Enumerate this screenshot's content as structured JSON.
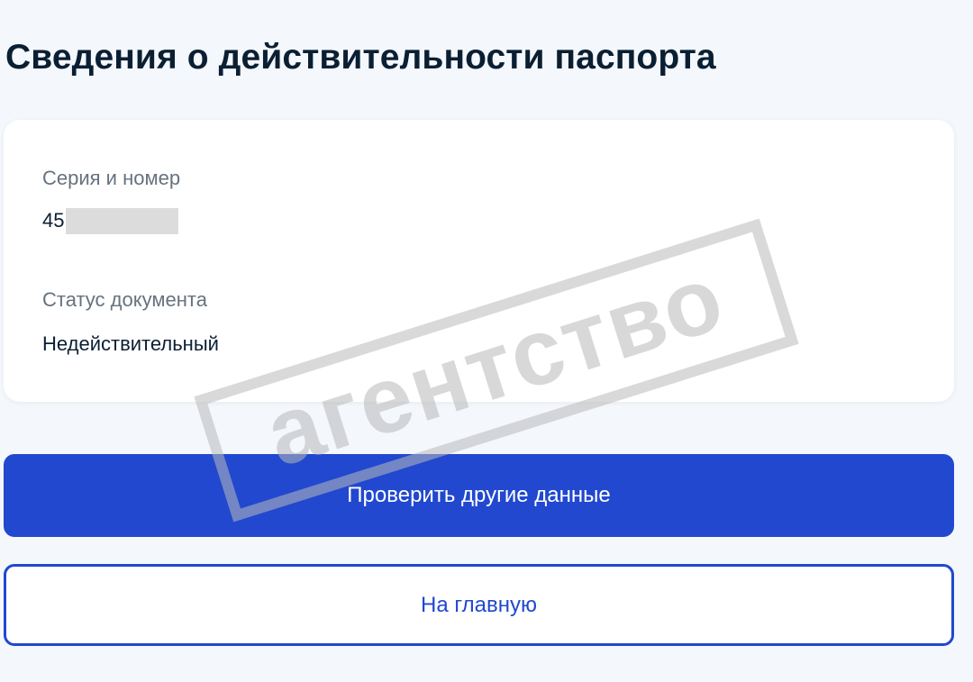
{
  "page": {
    "title": "Сведения о действительности паспорта"
  },
  "card": {
    "series_label": "Серия и номер",
    "series_value_visible": "45",
    "status_label": "Статус документа",
    "status_value": "Недействительный"
  },
  "buttons": {
    "check_other": "Проверить другие данные",
    "home": "На главную"
  },
  "watermark": {
    "text": "агентство"
  },
  "colors": {
    "background": "#f4f7fc",
    "accent": "#2148cf",
    "text_primary": "#0b1f33",
    "text_secondary": "#66727f",
    "watermark": "#b9b9b9"
  }
}
